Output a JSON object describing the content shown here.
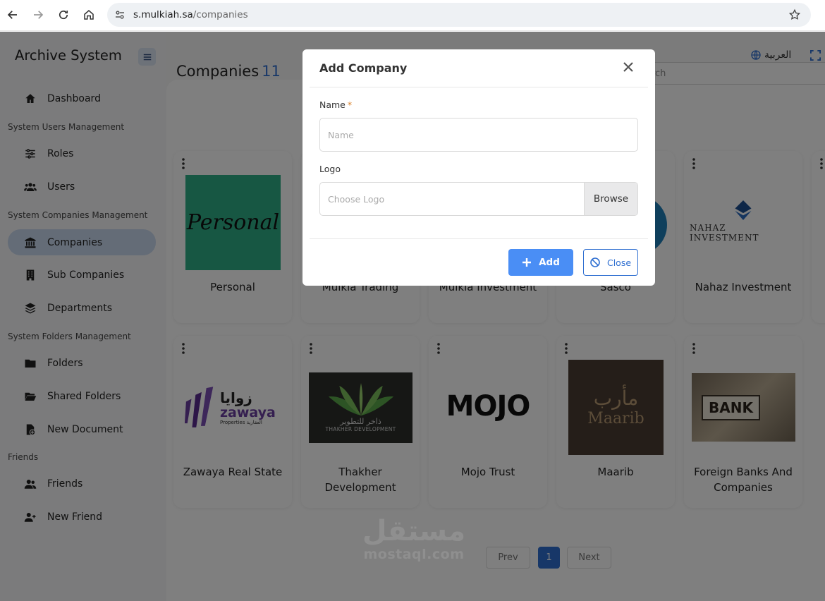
{
  "browser": {
    "url_host": "s.mulkiah.sa",
    "url_path": "/companies"
  },
  "app": {
    "brand": "Archive System",
    "language_switch": "العربية",
    "page_title": "Companies",
    "company_count": "11",
    "search_placeholder": "arch"
  },
  "sidebar": {
    "dashboard": "Dashboard",
    "section_users": "System Users Management",
    "roles": "Roles",
    "users": "Users",
    "section_companies": "System Companies Management",
    "companies": "Companies",
    "sub_companies": "Sub Companies",
    "departments": "Departments",
    "section_folders": "System Folders Management",
    "folders": "Folders",
    "shared_folders": "Shared Folders",
    "new_document": "New Document",
    "section_friends": "Friends",
    "friends": "Friends",
    "new_friend": "New Friend"
  },
  "companies": [
    {
      "name": "Personal",
      "logo_text": "Personal"
    },
    {
      "name": "Mulkia Trading"
    },
    {
      "name": "Mulkia Investment"
    },
    {
      "name": "Sasco"
    },
    {
      "name": "Nahaz Investment",
      "logo_text": "NAHAZ INVESTMENT"
    },
    {
      "name": "Zawaya Real State",
      "logo_text_ar": "زوايا",
      "logo_text": "zawaya",
      "logo_sub": "Properties العقارية"
    },
    {
      "name": "Thakher Development",
      "logo_text_ar": "ذاخر للتطوير",
      "logo_text": "THAKHER DEVELOPMENT"
    },
    {
      "name": "Mojo Trust",
      "logo_text": "MOJO"
    },
    {
      "name": "Maarib",
      "logo_text_ar": "مأرب",
      "logo_text": "Maarib"
    },
    {
      "name": "Foreign Banks And Companies",
      "logo_text": "BANK"
    }
  ],
  "pagination": {
    "prev": "Prev",
    "current": "1",
    "next": "Next"
  },
  "watermark": {
    "arabic": "مستقل",
    "latin": "mostaql.com"
  },
  "modal": {
    "title": "Add Company",
    "name_label": "Name",
    "required_mark": "*",
    "name_placeholder": "Name",
    "logo_label": "Logo",
    "logo_placeholder": "Choose Logo",
    "browse": "Browse",
    "add": "Add",
    "close": "Close"
  },
  "colors": {
    "accent": "#2f6fd1",
    "add_button": "#4a8ef5",
    "active_nav": "#c9d9ee",
    "overlay": "rgba(0,0,0,0.5)"
  }
}
